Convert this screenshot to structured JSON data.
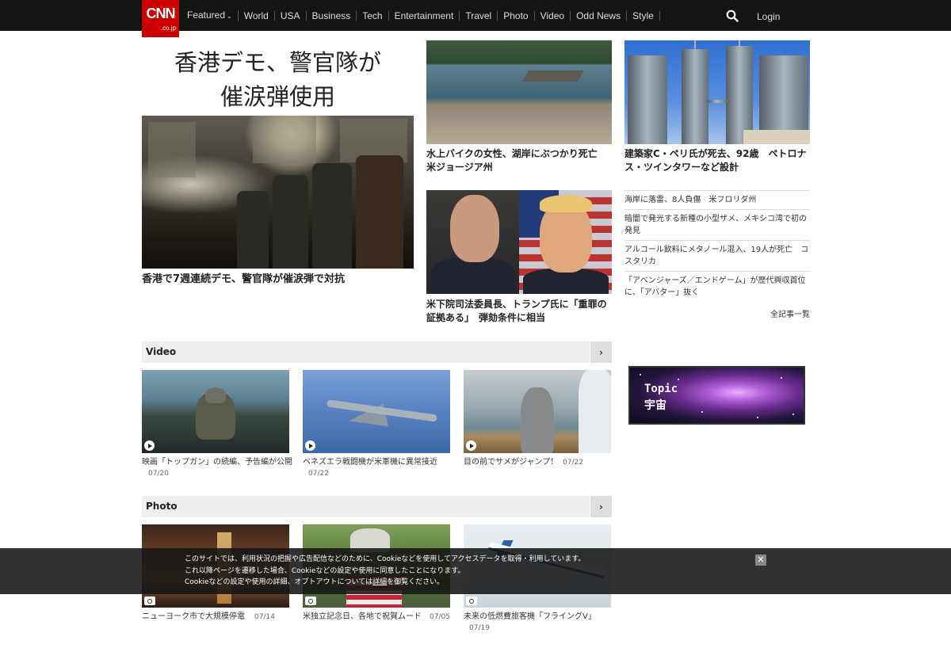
{
  "header": {
    "logo_top": "CNN",
    "logo_sub": ".co.jp",
    "nav": [
      "Featured",
      "World",
      "USA",
      "Business",
      "Tech",
      "Entertainment",
      "Travel",
      "Photo",
      "Video",
      "Odd News",
      "Style"
    ],
    "featured_chevron": "⌄",
    "login": "Login"
  },
  "hero": {
    "headline_line1": "香港デモ、警官隊が",
    "headline_line2": "催涙弾使用",
    "caption": "香港で7週連続デモ、警官隊が催涙弾で対抗"
  },
  "stories": {
    "lake_caption": "水上バイクの女性、湖岸にぶつかり死亡　米ジョージア州",
    "tower_caption": "建築家C・ペリ氏が死去、92歳　ペトロナス・ツインタワーなど設計",
    "politics_caption": "米下院司法委員長、トランプ氏に「重罪の証拠ある」　弾劾条件に相当"
  },
  "headlines": [
    "海岸に落雷、8人負傷　米フロリダ州",
    "暗闇で発光する新種の小型ザメ、メキシコ湾で初の発見",
    "アルコール飲料にメタノール混入、19人が死亡　コスタリカ",
    "「アベンジャーズ／エンドゲーム」が歴代興収首位に、「アバター」抜く"
  ],
  "all_articles": "全記事一覧",
  "video": {
    "title": "Video",
    "more": "›",
    "items": [
      {
        "caption": "映画「トップガン」の続編、予告編が公開",
        "date": "07/20"
      },
      {
        "caption": "ベネズエラ戦闘機が米軍機に異常接近",
        "date": "07/22"
      },
      {
        "caption": "目の前でサメがジャンプ！",
        "date": "07/22"
      }
    ]
  },
  "photo": {
    "title": "Photo",
    "more": "›",
    "items": [
      {
        "caption": "ニューヨーク市で大規模停電",
        "date": "07/14"
      },
      {
        "caption": "米独立記念日、各地で祝賀ムード",
        "date": "07/05"
      },
      {
        "caption": "未来の低燃費旅客機「フライングV」",
        "date": "07/19"
      }
    ]
  },
  "topic": {
    "label": "Topic",
    "name": "宇宙"
  },
  "cookie": {
    "line1": "このサイトでは、利用状況の把握や広告配信などのために、Cookieなどを使用してアクセスデータを取得・利用しています。",
    "line2": "これ以降ページを遷移した場合、Cookieなどの設定や使用に同意したことになります。",
    "line3_pre": "Cookieなどの設定や使用の詳細、オプトアウトについては",
    "line3_link": "詳細",
    "line3_post": "を御覧ください。",
    "close": "✕"
  }
}
